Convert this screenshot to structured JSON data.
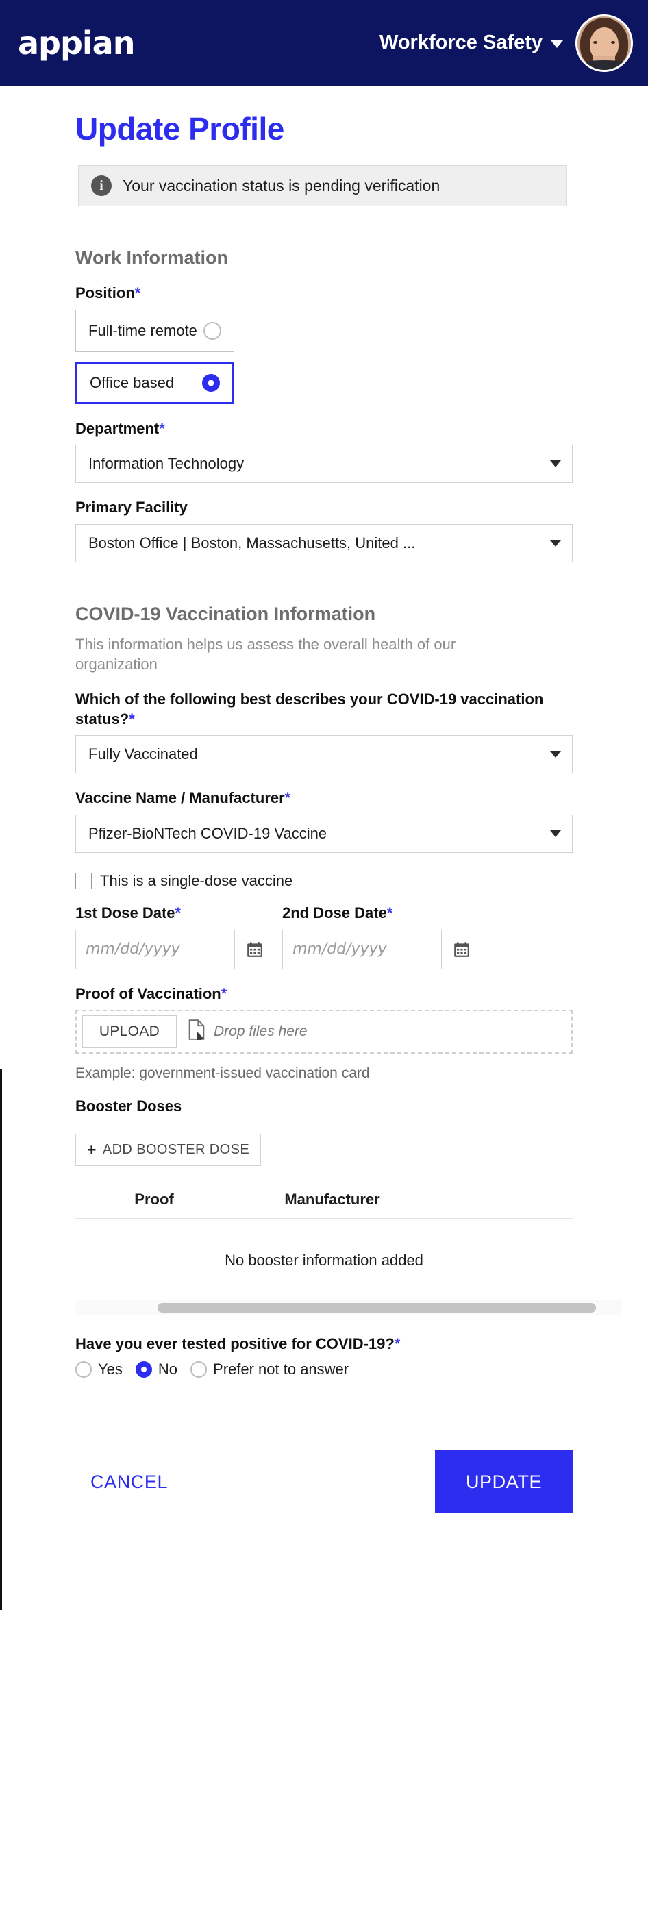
{
  "topbar": {
    "brand": "appian",
    "site_name": "Workforce Safety",
    "caret_icon": "chevron-down-icon",
    "avatar_alt": "user-avatar"
  },
  "page": {
    "title": "Update Profile",
    "title_color": "#2d2df0"
  },
  "alert": {
    "icon": "info-icon",
    "message": "Your vaccination status is pending verification",
    "background": "#efefef"
  },
  "work_information": {
    "section_title": "Work Information",
    "position": {
      "label": "Position",
      "required_marker": "*",
      "options": [
        {
          "label": "Full-time remote",
          "selected": false
        },
        {
          "label": "Office based",
          "selected": true
        }
      ]
    },
    "department": {
      "label": "Department",
      "required_marker": "*",
      "value": "Information Technology",
      "caret_icon": "chevron-down-icon"
    },
    "primary_facility": {
      "label": "Primary Facility",
      "required_marker": "",
      "value": "Boston Office | Boston, Massachusetts, United ...",
      "caret_icon": "chevron-down-icon"
    }
  },
  "covid_section": {
    "section_title": "COVID-19 Vaccination Information",
    "section_subtitle": "This information helps us assess the overall health of our organization",
    "status": {
      "label": "Which of the following best describes your COVID-19 vaccination status?",
      "required_marker": "*",
      "value": "Fully Vaccinated",
      "caret_icon": "chevron-down-icon"
    },
    "vaccine": {
      "label": "Vaccine Name / Manufacturer",
      "required_marker": "*",
      "value": "Pfizer-BioNTech COVID-19 Vaccine",
      "caret_icon": "chevron-down-icon"
    },
    "single_dose": {
      "label": "This is a single-dose vaccine",
      "checked": false
    },
    "dose1": {
      "label": "1st Dose Date",
      "required_marker": "*",
      "placeholder": "mm/dd/yyyy",
      "value": "",
      "calendar_icon": "calendar-icon"
    },
    "dose2": {
      "label": "2nd Dose Date",
      "required_marker": "*",
      "placeholder": "mm/dd/yyyy",
      "value": "",
      "calendar_icon": "calendar-icon"
    },
    "proof": {
      "label": "Proof of Vaccination",
      "required_marker": "*",
      "upload_button": "UPLOAD",
      "drop_hint": "Drop files here",
      "file_icon": "file-drop-icon",
      "example_text": "Example: government-issued vaccination card"
    },
    "boosters": {
      "label": "Booster Doses",
      "add_button": "ADD BOOSTER DOSE",
      "add_icon": "plus-icon",
      "columns": [
        "Proof",
        "Manufacturer"
      ],
      "rows": [],
      "empty_message": "No booster information added"
    },
    "tested_positive": {
      "label": "Have you ever tested positive for COVID-19?",
      "required_marker": "*",
      "options": [
        {
          "label": "Yes",
          "selected": false
        },
        {
          "label": "No",
          "selected": true
        },
        {
          "label": "Prefer not to answer",
          "selected": false
        }
      ]
    }
  },
  "footer": {
    "cancel_label": "CANCEL",
    "update_label": "UPDATE",
    "accent_color": "#2d2df0"
  }
}
